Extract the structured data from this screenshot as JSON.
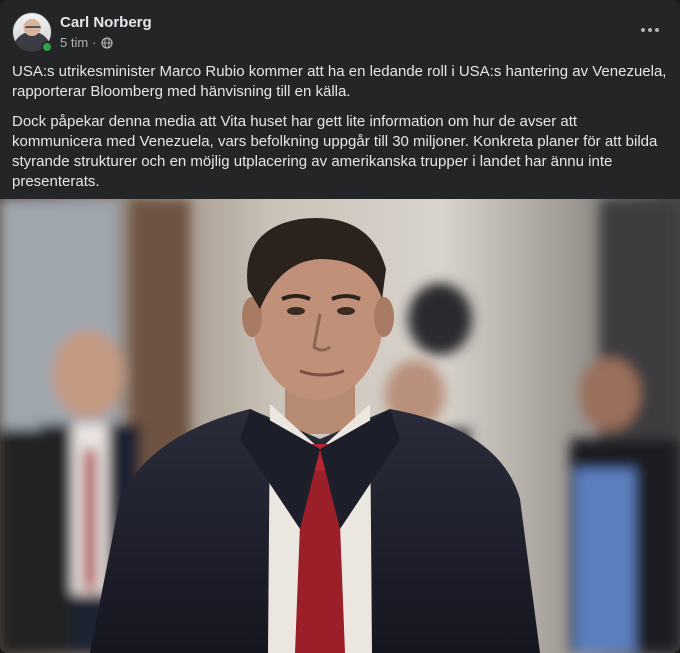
{
  "post": {
    "author": "Carl Norberg",
    "time": "5 tim",
    "separator": "·",
    "privacy_icon": "globe-icon",
    "more_icon": "more-horizontal-icon",
    "paragraphs": [
      "USA:s utrikesminister Marco Rubio kommer att ha en ledande roll i USA:s hantering av Venezuela, rapporterar Bloomberg med hänvisning till en källa.",
      "Dock påpekar denna media att Vita huset har gett lite information om hur de avser att kommunicera med Venezuela, vars befolkning uppgår till 30 miljoner. Konkreta planer för att bilda styrande strukturer och en möjlig utplacering av amerikanska trupper i landet har ännu inte presenterats."
    ]
  },
  "colors": {
    "card_bg": "#242526",
    "text_primary": "#e4e6eb",
    "text_secondary": "#b0b3b8",
    "online": "#31a24c"
  }
}
